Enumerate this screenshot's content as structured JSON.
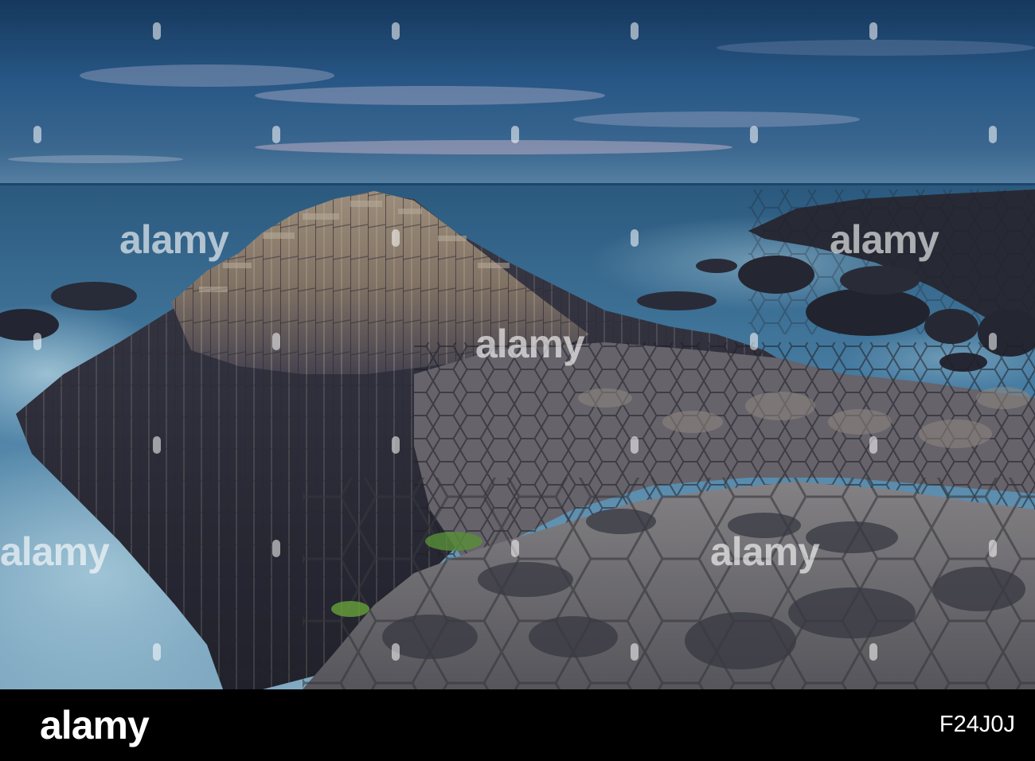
{
  "watermark": {
    "text": "alamy"
  },
  "footer": {
    "brand": "alamy",
    "image_id": "F24J0J"
  },
  "colors": {
    "sky": "#2b5d8f",
    "sea": "#4d86ad",
    "basalt_light": "#b3a493",
    "basalt_dark": "#353542",
    "footer": "#000000"
  }
}
